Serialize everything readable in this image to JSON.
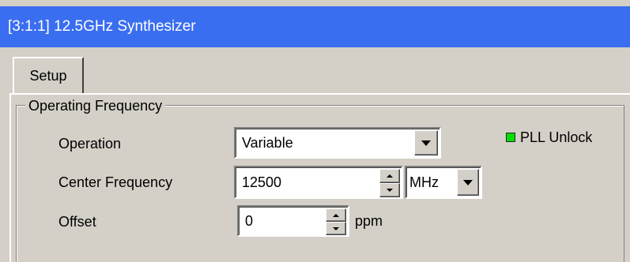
{
  "window": {
    "title": "[3:1:1] 12.5GHz Synthesizer"
  },
  "tabs": [
    {
      "label": "Setup",
      "selected": true
    }
  ],
  "group": {
    "label": "Operating Frequency",
    "operation": {
      "label": "Operation",
      "value": "Variable"
    },
    "center_frequency": {
      "label": "Center Frequency",
      "value": "12500",
      "unit": "MHz"
    },
    "offset": {
      "label": "Offset",
      "value": "0",
      "unit": "ppm"
    },
    "pll_indicator": {
      "label": "PLL Unlock",
      "color": "#00e000"
    }
  },
  "colors": {
    "title_bar": "#3a6ef0",
    "window_bg": "#d4d0c8"
  },
  "icons": [
    "dropdown-arrow-icon",
    "spin-up-icon",
    "spin-down-icon",
    "led-indicator-icon"
  ]
}
